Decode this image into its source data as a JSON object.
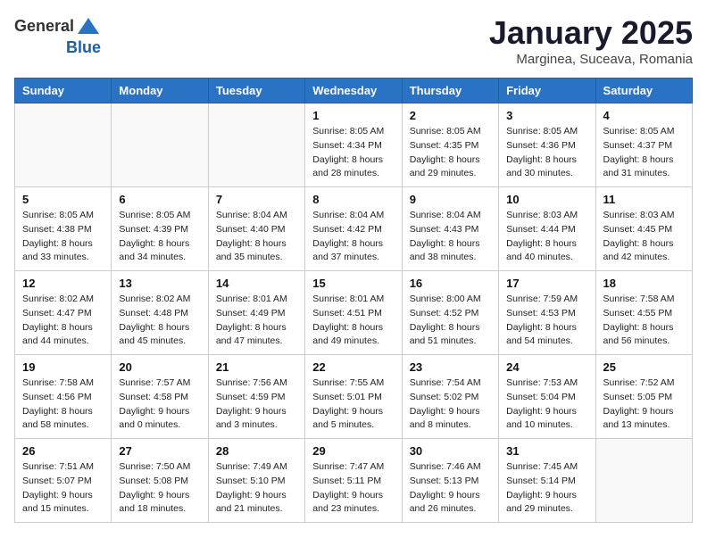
{
  "header": {
    "logo_general": "General",
    "logo_blue": "Blue",
    "title": "January 2025",
    "location": "Marginea, Suceava, Romania"
  },
  "weekdays": [
    "Sunday",
    "Monday",
    "Tuesday",
    "Wednesday",
    "Thursday",
    "Friday",
    "Saturday"
  ],
  "weeks": [
    [
      {
        "day": "",
        "info": ""
      },
      {
        "day": "",
        "info": ""
      },
      {
        "day": "",
        "info": ""
      },
      {
        "day": "1",
        "info": "Sunrise: 8:05 AM\nSunset: 4:34 PM\nDaylight: 8 hours\nand 28 minutes."
      },
      {
        "day": "2",
        "info": "Sunrise: 8:05 AM\nSunset: 4:35 PM\nDaylight: 8 hours\nand 29 minutes."
      },
      {
        "day": "3",
        "info": "Sunrise: 8:05 AM\nSunset: 4:36 PM\nDaylight: 8 hours\nand 30 minutes."
      },
      {
        "day": "4",
        "info": "Sunrise: 8:05 AM\nSunset: 4:37 PM\nDaylight: 8 hours\nand 31 minutes."
      }
    ],
    [
      {
        "day": "5",
        "info": "Sunrise: 8:05 AM\nSunset: 4:38 PM\nDaylight: 8 hours\nand 33 minutes."
      },
      {
        "day": "6",
        "info": "Sunrise: 8:05 AM\nSunset: 4:39 PM\nDaylight: 8 hours\nand 34 minutes."
      },
      {
        "day": "7",
        "info": "Sunrise: 8:04 AM\nSunset: 4:40 PM\nDaylight: 8 hours\nand 35 minutes."
      },
      {
        "day": "8",
        "info": "Sunrise: 8:04 AM\nSunset: 4:42 PM\nDaylight: 8 hours\nand 37 minutes."
      },
      {
        "day": "9",
        "info": "Sunrise: 8:04 AM\nSunset: 4:43 PM\nDaylight: 8 hours\nand 38 minutes."
      },
      {
        "day": "10",
        "info": "Sunrise: 8:03 AM\nSunset: 4:44 PM\nDaylight: 8 hours\nand 40 minutes."
      },
      {
        "day": "11",
        "info": "Sunrise: 8:03 AM\nSunset: 4:45 PM\nDaylight: 8 hours\nand 42 minutes."
      }
    ],
    [
      {
        "day": "12",
        "info": "Sunrise: 8:02 AM\nSunset: 4:47 PM\nDaylight: 8 hours\nand 44 minutes."
      },
      {
        "day": "13",
        "info": "Sunrise: 8:02 AM\nSunset: 4:48 PM\nDaylight: 8 hours\nand 45 minutes."
      },
      {
        "day": "14",
        "info": "Sunrise: 8:01 AM\nSunset: 4:49 PM\nDaylight: 8 hours\nand 47 minutes."
      },
      {
        "day": "15",
        "info": "Sunrise: 8:01 AM\nSunset: 4:51 PM\nDaylight: 8 hours\nand 49 minutes."
      },
      {
        "day": "16",
        "info": "Sunrise: 8:00 AM\nSunset: 4:52 PM\nDaylight: 8 hours\nand 51 minutes."
      },
      {
        "day": "17",
        "info": "Sunrise: 7:59 AM\nSunset: 4:53 PM\nDaylight: 8 hours\nand 54 minutes."
      },
      {
        "day": "18",
        "info": "Sunrise: 7:58 AM\nSunset: 4:55 PM\nDaylight: 8 hours\nand 56 minutes."
      }
    ],
    [
      {
        "day": "19",
        "info": "Sunrise: 7:58 AM\nSunset: 4:56 PM\nDaylight: 8 hours\nand 58 minutes."
      },
      {
        "day": "20",
        "info": "Sunrise: 7:57 AM\nSunset: 4:58 PM\nDaylight: 9 hours\nand 0 minutes."
      },
      {
        "day": "21",
        "info": "Sunrise: 7:56 AM\nSunset: 4:59 PM\nDaylight: 9 hours\nand 3 minutes."
      },
      {
        "day": "22",
        "info": "Sunrise: 7:55 AM\nSunset: 5:01 PM\nDaylight: 9 hours\nand 5 minutes."
      },
      {
        "day": "23",
        "info": "Sunrise: 7:54 AM\nSunset: 5:02 PM\nDaylight: 9 hours\nand 8 minutes."
      },
      {
        "day": "24",
        "info": "Sunrise: 7:53 AM\nSunset: 5:04 PM\nDaylight: 9 hours\nand 10 minutes."
      },
      {
        "day": "25",
        "info": "Sunrise: 7:52 AM\nSunset: 5:05 PM\nDaylight: 9 hours\nand 13 minutes."
      }
    ],
    [
      {
        "day": "26",
        "info": "Sunrise: 7:51 AM\nSunset: 5:07 PM\nDaylight: 9 hours\nand 15 minutes."
      },
      {
        "day": "27",
        "info": "Sunrise: 7:50 AM\nSunset: 5:08 PM\nDaylight: 9 hours\nand 18 minutes."
      },
      {
        "day": "28",
        "info": "Sunrise: 7:49 AM\nSunset: 5:10 PM\nDaylight: 9 hours\nand 21 minutes."
      },
      {
        "day": "29",
        "info": "Sunrise: 7:47 AM\nSunset: 5:11 PM\nDaylight: 9 hours\nand 23 minutes."
      },
      {
        "day": "30",
        "info": "Sunrise: 7:46 AM\nSunset: 5:13 PM\nDaylight: 9 hours\nand 26 minutes."
      },
      {
        "day": "31",
        "info": "Sunrise: 7:45 AM\nSunset: 5:14 PM\nDaylight: 9 hours\nand 29 minutes."
      },
      {
        "day": "",
        "info": ""
      }
    ]
  ]
}
